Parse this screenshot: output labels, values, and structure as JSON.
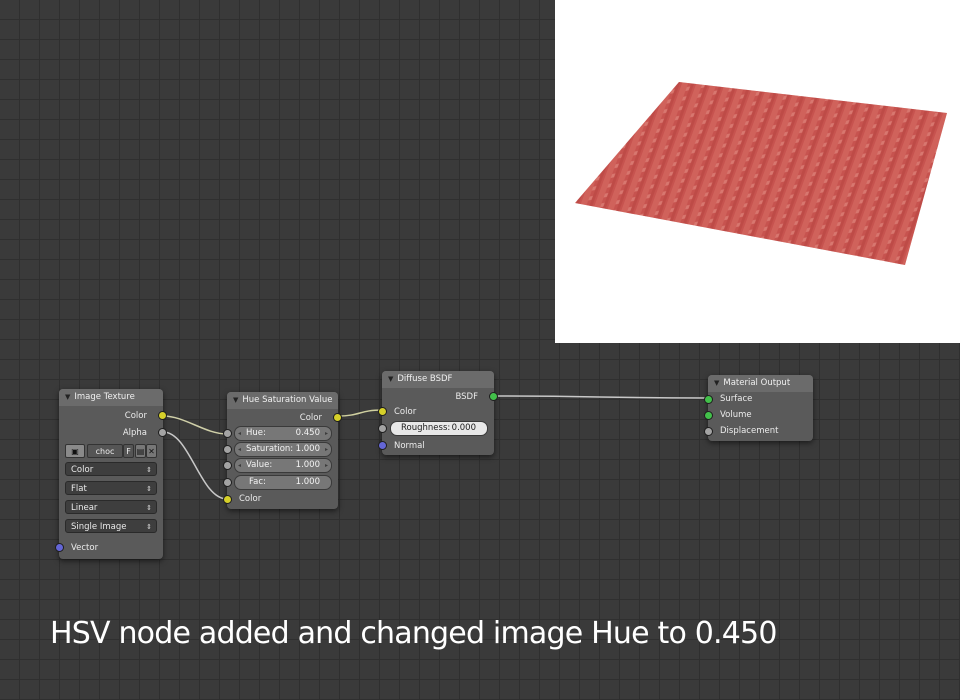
{
  "caption": "HSV node added and changed image Hue to 0.450",
  "image_texture": {
    "title": "Image Texture",
    "outputs": {
      "color": "Color",
      "alpha": "Alpha"
    },
    "image_name": "choc",
    "fake_user": "F",
    "color_space": "Color",
    "projection": "Flat",
    "interpolation": "Linear",
    "source": "Single Image",
    "input_vector": "Vector"
  },
  "hsv": {
    "title": "Hue Saturation Value",
    "output_color": "Color",
    "hue_label": "Hue:",
    "hue_value": "0.450",
    "sat_label": "Saturation:",
    "sat_value": "1.000",
    "val_label": "Value:",
    "val_value": "1.000",
    "fac_label": "Fac:",
    "fac_value": "1.000",
    "input_color": "Color"
  },
  "diffuse": {
    "title": "Diffuse BSDF",
    "output_bsdf": "BSDF",
    "input_color": "Color",
    "roughness_label": "Roughness:",
    "roughness_value": "0.000",
    "input_normal": "Normal"
  },
  "material_output": {
    "title": "Material Output",
    "surface": "Surface",
    "volume": "Volume",
    "displacement": "Displacement"
  },
  "colors": {
    "background": "#3a3a3a",
    "node_body": "#5a5a5a",
    "color_socket": "#d6d02a",
    "vector_socket": "#6466d6",
    "shader_socket": "#42c04a",
    "value_socket": "#a3a3a3",
    "render_surface": "#c8524e"
  }
}
